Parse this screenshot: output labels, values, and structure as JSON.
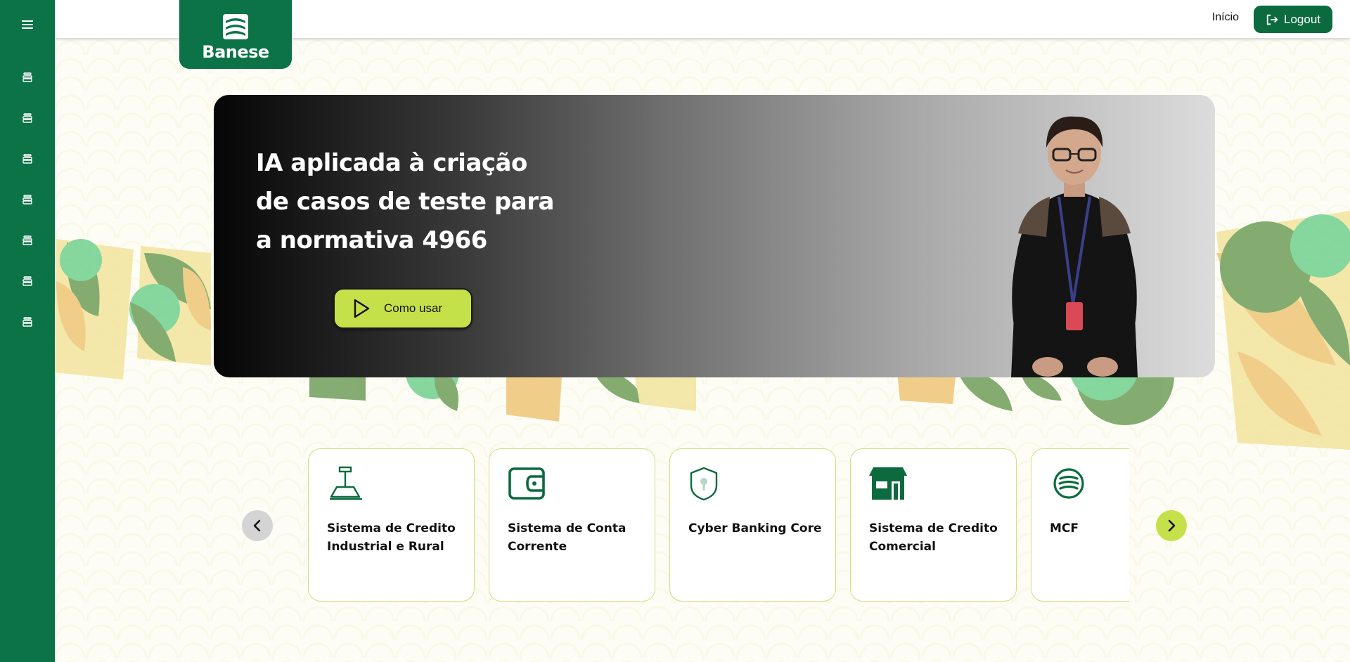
{
  "sidebar": {
    "menu_icon": "hamburger-menu-icon",
    "items": [
      {
        "icon": "stack-icon"
      },
      {
        "icon": "stack-icon"
      },
      {
        "icon": "stack-icon"
      },
      {
        "icon": "stack-icon"
      },
      {
        "icon": "stack-icon"
      },
      {
        "icon": "stack-icon"
      },
      {
        "icon": "stack-icon"
      }
    ]
  },
  "header": {
    "logo_text": "Banese",
    "nav_home": "Início",
    "logout_label": "Logout"
  },
  "hero": {
    "title_line1": "IA aplicada à criação",
    "title_line2": "de casos de teste para",
    "title_line3": "a normativa 4966",
    "button_label": "Como usar"
  },
  "cards": [
    {
      "label": "Sistema de Credito Industrial e Rural",
      "icon": "scale-icon"
    },
    {
      "label": "Sistema de Conta Corrente",
      "icon": "wallet-icon"
    },
    {
      "label": "Cyber Banking Core",
      "icon": "shield-key-icon"
    },
    {
      "label": "Sistema de Credito Comercial",
      "icon": "store-icon"
    },
    {
      "label": "MCF",
      "icon": "banese-logo-icon"
    }
  ],
  "colors": {
    "primary_green": "#0b7346",
    "accent_lime": "#c5e14a",
    "card_border": "#cfe07a"
  }
}
